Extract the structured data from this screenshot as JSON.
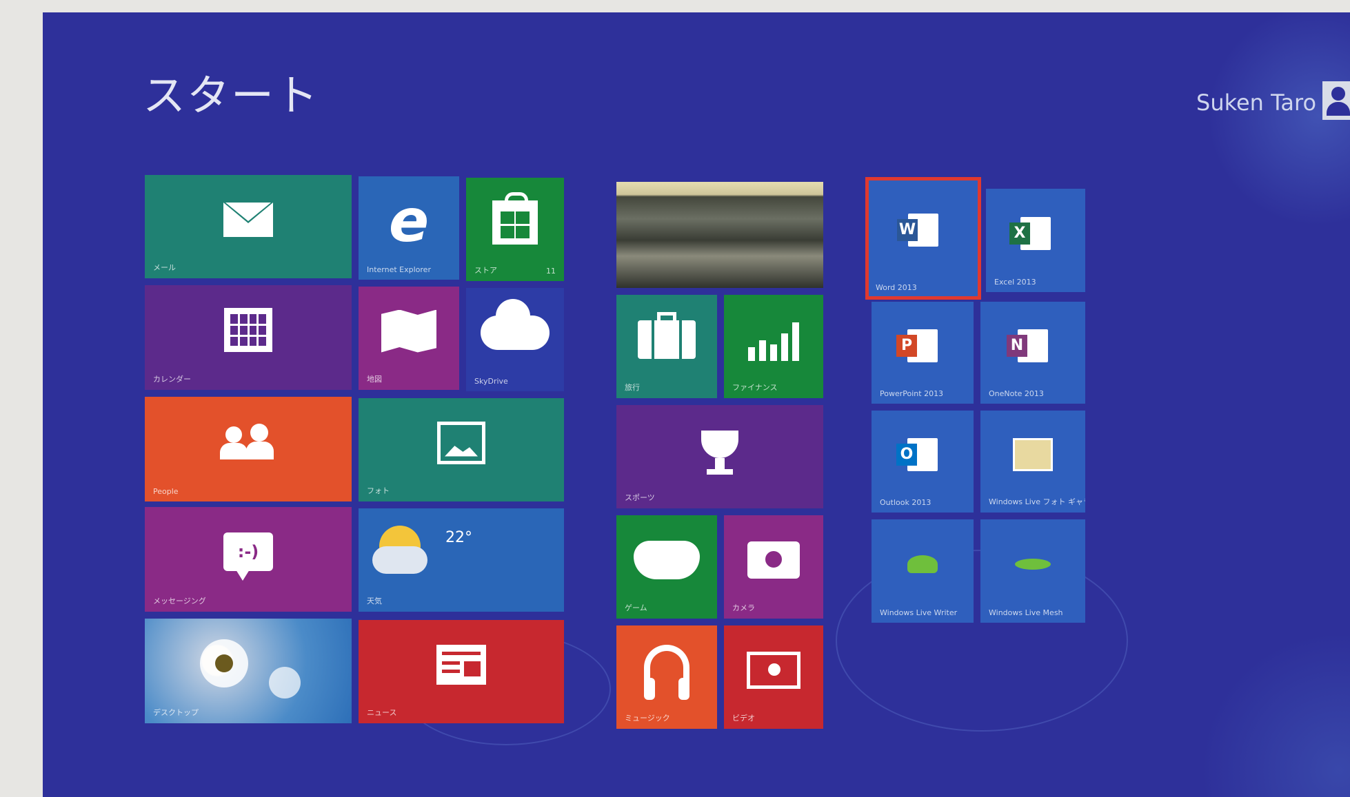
{
  "start": {
    "title": "スタート"
  },
  "user": {
    "name": "Suken Taro"
  },
  "tiles": {
    "mail": {
      "label": "メール",
      "icon": "mail-icon"
    },
    "ie": {
      "label": "Internet Explorer",
      "icon": "internet-explorer-icon",
      "glyph": "e"
    },
    "store": {
      "label": "ストア",
      "badge": "11",
      "icon": "store-icon"
    },
    "photo_live": {
      "label": "",
      "icon": "landscape-photo"
    },
    "calendar": {
      "label": "カレンダー",
      "icon": "calendar-icon"
    },
    "maps": {
      "label": "地図",
      "icon": "map-icon"
    },
    "skydrive": {
      "label": "SkyDrive",
      "icon": "cloud-icon"
    },
    "travel": {
      "label": "旅行",
      "icon": "suitcase-icon"
    },
    "finance": {
      "label": "ファイナンス",
      "icon": "stock-chart-icon"
    },
    "people": {
      "label": "People",
      "icon": "people-icon"
    },
    "photos": {
      "label": "フォト",
      "icon": "photos-icon"
    },
    "sports": {
      "label": "スポーツ",
      "icon": "trophy-icon"
    },
    "messaging": {
      "label": "メッセージング",
      "icon": "chat-icon",
      "glyph": ":-)"
    },
    "weather": {
      "label": "天気",
      "icon": "weather-icon",
      "temp": "22°"
    },
    "games": {
      "label": "ゲーム",
      "icon": "game-controller-icon"
    },
    "camera": {
      "label": "カメラ",
      "icon": "camera-icon"
    },
    "desktop": {
      "label": "デスクトップ",
      "icon": "desktop-wallpaper"
    },
    "news": {
      "label": "ニュース",
      "icon": "news-icon"
    },
    "music": {
      "label": "ミュージック",
      "icon": "headphones-icon"
    },
    "video": {
      "label": "ビデオ",
      "icon": "video-icon"
    },
    "word": {
      "label": "Word 2013",
      "icon": "word-icon",
      "letter": "W"
    },
    "excel": {
      "label": "Excel 2013",
      "icon": "excel-icon",
      "letter": "X"
    },
    "powerpoint": {
      "label": "PowerPoint 2013",
      "icon": "powerpoint-icon",
      "letter": "P"
    },
    "onenote": {
      "label": "OneNote 2013",
      "icon": "onenote-icon",
      "letter": "N"
    },
    "outlook": {
      "label": "Outlook 2013",
      "icon": "outlook-icon",
      "letter": "O"
    },
    "live_gallery": {
      "label": "Windows Live フォト ギャラリー",
      "icon": "photo-gallery-icon"
    },
    "live_writer": {
      "label": "Windows Live Writer",
      "icon": "live-writer-icon"
    },
    "live_mesh": {
      "label": "Windows Live Mesh",
      "icon": "live-mesh-icon"
    }
  },
  "colors": {
    "background": "#2e309a",
    "selection_outline": "#e0392f"
  }
}
